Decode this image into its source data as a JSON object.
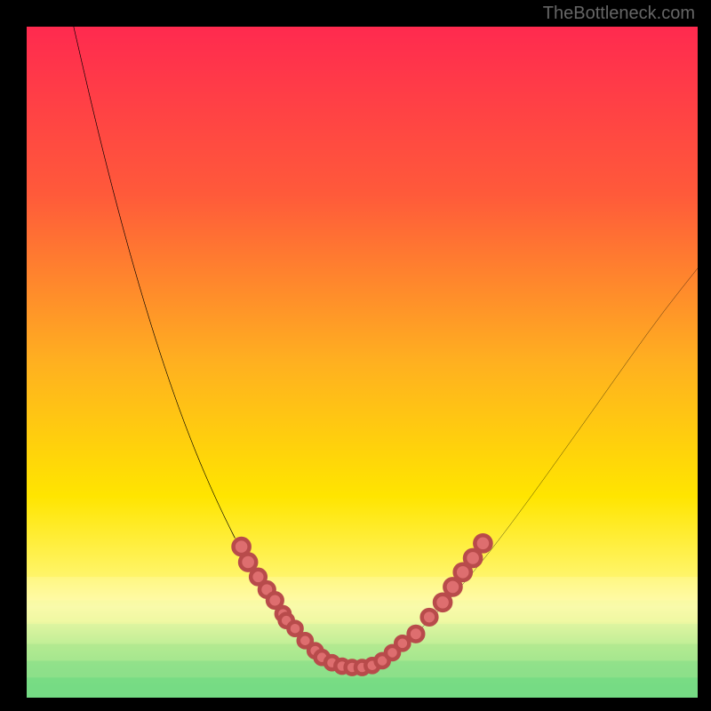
{
  "watermark": "TheBottleneck.com",
  "chart_data": {
    "type": "line",
    "title": "",
    "xlabel": "",
    "ylabel": "",
    "xlim": [
      0,
      100
    ],
    "ylim": [
      0,
      100
    ],
    "grid": false,
    "legend": false,
    "background": {
      "type": "vertical_gradient",
      "stops": [
        {
          "pos": 0.0,
          "color": "#ff2a4f"
        },
        {
          "pos": 0.25,
          "color": "#ff5a3a"
        },
        {
          "pos": 0.5,
          "color": "#ffb020"
        },
        {
          "pos": 0.7,
          "color": "#ffe500"
        },
        {
          "pos": 0.82,
          "color": "#fff56a"
        },
        {
          "pos": 0.865,
          "color": "#fffbb0"
        },
        {
          "pos": 0.885,
          "color": "#ecf7a0"
        },
        {
          "pos": 0.92,
          "color": "#8be080"
        },
        {
          "pos": 0.955,
          "color": "#3fce78"
        },
        {
          "pos": 1.0,
          "color": "#13c270"
        }
      ]
    },
    "bands": [
      {
        "y_top": 82.0,
        "color": "#fffbb0",
        "opacity": 0.35
      },
      {
        "y_top": 85.5,
        "color": "#ecf7a0",
        "opacity": 0.3
      },
      {
        "y_top": 89.0,
        "color": "#bceea0",
        "opacity": 0.25
      },
      {
        "y_top": 92.0,
        "color": "#8be080",
        "opacity": 0.25
      },
      {
        "y_top": 94.5,
        "color": "#5cd57a",
        "opacity": 0.25
      },
      {
        "y_top": 97.0,
        "color": "#3fce78",
        "opacity": 0.25
      }
    ],
    "series": [
      {
        "name": "left_curve",
        "x": [
          7.0,
          10.0,
          13.0,
          16.0,
          19.0,
          22.0,
          25.0,
          28.0,
          31.0,
          34.0,
          36.0,
          38.0,
          40.0,
          42.0,
          44.0
        ],
        "y": [
          0.0,
          13.0,
          25.0,
          36.0,
          46.0,
          55.0,
          63.0,
          70.0,
          76.2,
          81.2,
          84.7,
          87.6,
          90.2,
          92.4,
          94.0
        ]
      },
      {
        "name": "bottom_curve",
        "x": [
          44.0,
          46.0,
          48.0,
          50.0,
          52.0,
          54.0
        ],
        "y": [
          94.0,
          95.0,
          95.5,
          95.5,
          94.9,
          93.8
        ]
      },
      {
        "name": "right_curve",
        "x": [
          54.0,
          58.0,
          62.0,
          66.0,
          70.0,
          75.0,
          80.0,
          85.0,
          90.0,
          95.0,
          100.0
        ],
        "y": [
          93.8,
          90.5,
          86.5,
          82.0,
          77.0,
          70.3,
          63.3,
          56.3,
          49.2,
          42.3,
          36.0
        ]
      }
    ],
    "points_series": {
      "name": "highlight_dots",
      "points": [
        {
          "x": 32.0,
          "y": 77.5,
          "r": 1.2
        },
        {
          "x": 33.0,
          "y": 79.8,
          "r": 1.2
        },
        {
          "x": 34.5,
          "y": 82.0,
          "r": 1.1
        },
        {
          "x": 35.8,
          "y": 83.9,
          "r": 1.1
        },
        {
          "x": 37.0,
          "y": 85.5,
          "r": 1.1
        },
        {
          "x": 38.2,
          "y": 87.5,
          "r": 1.0
        },
        {
          "x": 38.7,
          "y": 88.5,
          "r": 1.0
        },
        {
          "x": 40.0,
          "y": 89.7,
          "r": 1.0
        },
        {
          "x": 41.5,
          "y": 91.5,
          "r": 1.0
        },
        {
          "x": 43.0,
          "y": 93.0,
          "r": 1.0
        },
        {
          "x": 44.0,
          "y": 94.0,
          "r": 1.0
        },
        {
          "x": 45.5,
          "y": 94.8,
          "r": 1.0
        },
        {
          "x": 47.0,
          "y": 95.3,
          "r": 1.0
        },
        {
          "x": 48.5,
          "y": 95.5,
          "r": 1.0
        },
        {
          "x": 50.0,
          "y": 95.5,
          "r": 1.0
        },
        {
          "x": 51.5,
          "y": 95.2,
          "r": 1.0
        },
        {
          "x": 53.0,
          "y": 94.5,
          "r": 1.0
        },
        {
          "x": 54.5,
          "y": 93.3,
          "r": 1.0
        },
        {
          "x": 56.0,
          "y": 91.9,
          "r": 1.0
        },
        {
          "x": 58.0,
          "y": 90.5,
          "r": 1.1
        },
        {
          "x": 60.0,
          "y": 88.0,
          "r": 1.1
        },
        {
          "x": 62.0,
          "y": 85.8,
          "r": 1.2
        },
        {
          "x": 63.5,
          "y": 83.5,
          "r": 1.2
        },
        {
          "x": 65.0,
          "y": 81.3,
          "r": 1.2
        },
        {
          "x": 66.5,
          "y": 79.2,
          "r": 1.2
        },
        {
          "x": 68.0,
          "y": 77.0,
          "r": 1.2
        }
      ]
    }
  }
}
